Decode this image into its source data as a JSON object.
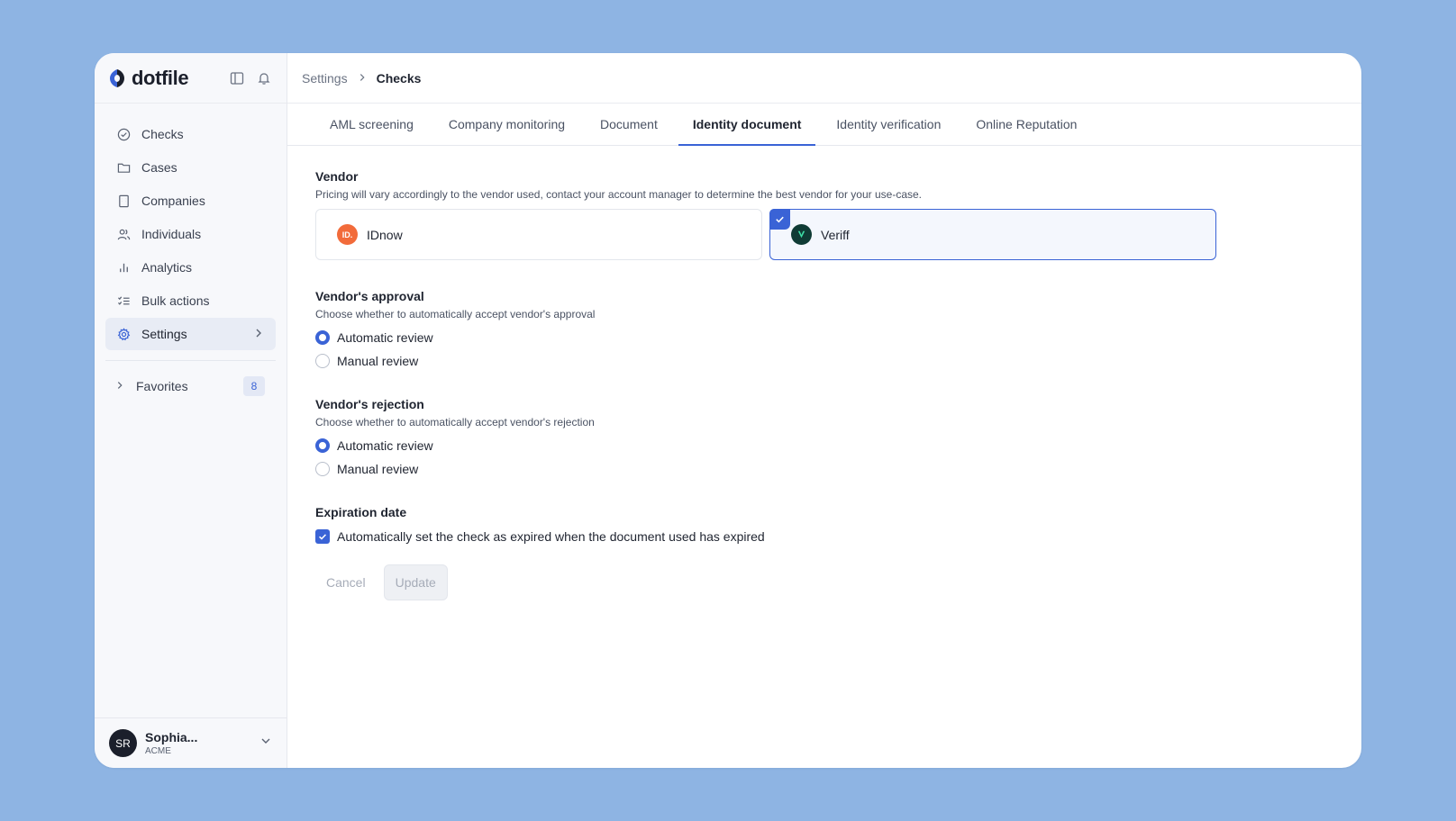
{
  "app": {
    "brand": "dotfile"
  },
  "sidebar": {
    "items": [
      {
        "label": "Checks",
        "icon": "check-circle-icon"
      },
      {
        "label": "Cases",
        "icon": "folder-icon"
      },
      {
        "label": "Companies",
        "icon": "building-icon"
      },
      {
        "label": "Individuals",
        "icon": "users-icon"
      },
      {
        "label": "Analytics",
        "icon": "bar-chart-icon"
      },
      {
        "label": "Bulk actions",
        "icon": "list-checks-icon"
      },
      {
        "label": "Settings",
        "icon": "gear-icon",
        "active": true
      }
    ],
    "favorites": {
      "label": "Favorites",
      "count": "8"
    },
    "user": {
      "initials": "SR",
      "name": "Sophia...",
      "org": "ACME"
    }
  },
  "breadcrumb": {
    "parent": "Settings",
    "current": "Checks"
  },
  "tabs": [
    {
      "label": "AML screening"
    },
    {
      "label": "Company monitoring"
    },
    {
      "label": "Document"
    },
    {
      "label": "Identity document",
      "active": true
    },
    {
      "label": "Identity verification"
    },
    {
      "label": "Online Reputation"
    }
  ],
  "vendor": {
    "title": "Vendor",
    "description": "Pricing will vary accordingly to the vendor used, contact your account manager to determine the best vendor for your use-case.",
    "options": [
      {
        "name": "IDnow",
        "logo_text": "ID.",
        "selected": false
      },
      {
        "name": "Veriff",
        "logo_text": "V",
        "selected": true
      }
    ]
  },
  "approval": {
    "title": "Vendor's approval",
    "description": "Choose whether to automatically accept vendor's approval",
    "options": [
      "Automatic review",
      "Manual review"
    ],
    "selected": "Automatic review"
  },
  "rejection": {
    "title": "Vendor's rejection",
    "description": "Choose whether to automatically accept vendor's rejection",
    "options": [
      "Automatic review",
      "Manual review"
    ],
    "selected": "Automatic review"
  },
  "expiration": {
    "title": "Expiration date",
    "checkbox_label": "Automatically set the check as expired when the document used has expired",
    "checked": true
  },
  "actions": {
    "cancel": "Cancel",
    "update": "Update"
  },
  "colors": {
    "accent": "#3a63d6",
    "background": "#8eb4e3",
    "idnow": "#f26b3a",
    "veriff": "#0f3b35"
  }
}
